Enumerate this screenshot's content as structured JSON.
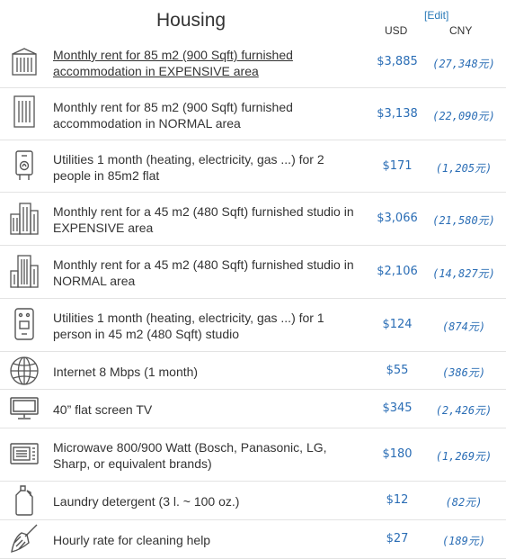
{
  "section": {
    "title": "Housing",
    "edit_label": "[Edit]",
    "col_usd": "USD",
    "col_cny": "CNY"
  },
  "rows": [
    {
      "label": "Monthly rent for 85 m2 (900 Sqft) furnished accommodation in EXPENSIVE area",
      "usd": "$3,885",
      "cny": "(27,348元)",
      "icon": "apartment-building-icon"
    },
    {
      "label": "Monthly rent for 85 m2 (900 Sqft) furnished accommodation in NORMAL area",
      "usd": "$3,138",
      "cny": "(22,090元)",
      "icon": "office-building-icon"
    },
    {
      "label": "Utilities 1 month (heating, electricity, gas ...) for 2 people in 85m2 flat",
      "usd": "$171",
      "cny": "(1,205元)",
      "icon": "boiler-icon"
    },
    {
      "label": "Monthly rent for a 45 m2 (480 Sqft) furnished studio in EXPENSIVE area",
      "usd": "$3,066",
      "cny": "(21,580元)",
      "icon": "city-buildings-icon"
    },
    {
      "label": "Monthly rent for a 45 m2 (480 Sqft) furnished studio in NORMAL area",
      "usd": "$2,106",
      "cny": "(14,827元)",
      "icon": "tower-building-icon"
    },
    {
      "label": "Utilities 1 month (heating, electricity, gas ...) for 1 person in 45 m2 (480 Sqft) studio",
      "usd": "$124",
      "cny": "(874元)",
      "icon": "meter-device-icon"
    },
    {
      "label": "Internet 8 Mbps (1 month)",
      "usd": "$55",
      "cny": "(386元)",
      "icon": "globe-icon"
    },
    {
      "label": "40” flat screen TV",
      "usd": "$345",
      "cny": "(2,426元)",
      "icon": "tv-screen-icon"
    },
    {
      "label": "Microwave 800/900 Watt (Bosch, Panasonic, LG, Sharp, or equivalent brands)",
      "usd": "$180",
      "cny": "(1,269元)",
      "icon": "microwave-icon"
    },
    {
      "label": "Laundry detergent (3 l. ~ 100 oz.)",
      "usd": "$12",
      "cny": "(82元)",
      "icon": "detergent-bottle-icon"
    },
    {
      "label": "Hourly rate for cleaning help",
      "usd": "$27",
      "cny": "(189元)",
      "icon": "broom-icon"
    }
  ]
}
